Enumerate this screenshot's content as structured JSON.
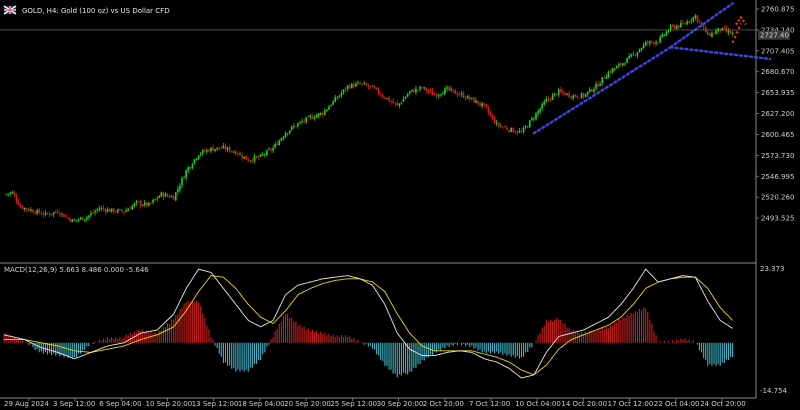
{
  "header": {
    "title": "GOLD, H4:  Gold (100 oz) vs US Dollar CFD",
    "flag_icon": "uk-flag-icon"
  },
  "colors": {
    "background": "#000000",
    "bull_candle": "#1fd41f",
    "bear_candle": "#e01d1d",
    "grid_separator": "#8a8a8a",
    "channel": "#3b47e6",
    "forecast_arrow": "#ff3030",
    "macd_line": "#e8e8e8",
    "signal_line": "#e8d800",
    "hist_positive": "#c81e1e",
    "hist_negative": "#3fb6c8",
    "text": "#d0d0d0"
  },
  "chart_data": [
    {
      "type": "candlestick",
      "symbol": "GOLD",
      "timeframe": "H4",
      "current_price": "2734.140",
      "bid_box": "2727.40",
      "y_ticks": [
        "2760.875",
        "2734.140",
        "2707.405",
        "2680.670",
        "2653.935",
        "2627.200",
        "2600.465",
        "2573.730",
        "2546.995",
        "2520.260",
        "2493.525"
      ],
      "ylim": [
        2466.79,
        2760.875
      ],
      "x_ticks": [
        "29 Aug 2024",
        "3 Sep 12:00",
        "6 Sep 04:00",
        "10 Sep 20:00",
        "13 Sep 12:00",
        "18 Sep 04:00",
        "20 Sep 20:00",
        "25 Sep 12:00",
        "30 Sep 20:00",
        "2 Oct 20:00",
        "7 Oct 12:00",
        "10 Oct 04:00",
        "14 Oct 20:00",
        "17 Oct 12:00",
        "22 Oct 04:00",
        "24 Oct 20:00"
      ],
      "close_path": [
        {
          "t": 0,
          "v": 2524
        },
        {
          "t": 4,
          "v": 2526
        },
        {
          "t": 8,
          "v": 2508
        },
        {
          "t": 14,
          "v": 2503
        },
        {
          "t": 20,
          "v": 2498
        },
        {
          "t": 26,
          "v": 2502
        },
        {
          "t": 33,
          "v": 2490
        },
        {
          "t": 40,
          "v": 2495
        },
        {
          "t": 46,
          "v": 2506
        },
        {
          "t": 52,
          "v": 2503
        },
        {
          "t": 58,
          "v": 2502
        },
        {
          "t": 64,
          "v": 2513
        },
        {
          "t": 70,
          "v": 2510
        },
        {
          "t": 76,
          "v": 2524
        },
        {
          "t": 82,
          "v": 2520
        },
        {
          "t": 88,
          "v": 2554
        },
        {
          "t": 94,
          "v": 2576
        },
        {
          "t": 100,
          "v": 2582
        },
        {
          "t": 106,
          "v": 2583
        },
        {
          "t": 112,
          "v": 2578
        },
        {
          "t": 118,
          "v": 2568
        },
        {
          "t": 124,
          "v": 2572
        },
        {
          "t": 130,
          "v": 2583
        },
        {
          "t": 136,
          "v": 2603
        },
        {
          "t": 142,
          "v": 2614
        },
        {
          "t": 148,
          "v": 2622
        },
        {
          "t": 154,
          "v": 2628
        },
        {
          "t": 160,
          "v": 2645
        },
        {
          "t": 166,
          "v": 2662
        },
        {
          "t": 172,
          "v": 2665
        },
        {
          "t": 178,
          "v": 2660
        },
        {
          "t": 184,
          "v": 2648
        },
        {
          "t": 190,
          "v": 2637
        },
        {
          "t": 196,
          "v": 2655
        },
        {
          "t": 202,
          "v": 2660
        },
        {
          "t": 208,
          "v": 2651
        },
        {
          "t": 214,
          "v": 2658
        },
        {
          "t": 220,
          "v": 2652
        },
        {
          "t": 226,
          "v": 2645
        },
        {
          "t": 232,
          "v": 2636
        },
        {
          "t": 238,
          "v": 2613
        },
        {
          "t": 244,
          "v": 2607
        },
        {
          "t": 250,
          "v": 2603
        },
        {
          "t": 256,
          "v": 2623
        },
        {
          "t": 262,
          "v": 2644
        },
        {
          "t": 268,
          "v": 2655
        },
        {
          "t": 274,
          "v": 2650
        },
        {
          "t": 280,
          "v": 2650
        },
        {
          "t": 286,
          "v": 2662
        },
        {
          "t": 292,
          "v": 2680
        },
        {
          "t": 298,
          "v": 2690
        },
        {
          "t": 304,
          "v": 2702
        },
        {
          "t": 310,
          "v": 2717
        },
        {
          "t": 316,
          "v": 2720
        },
        {
          "t": 322,
          "v": 2737
        },
        {
          "t": 328,
          "v": 2741
        },
        {
          "t": 334,
          "v": 2752
        },
        {
          "t": 337,
          "v": 2740
        },
        {
          "t": 340,
          "v": 2727
        },
        {
          "t": 346,
          "v": 2735
        },
        {
          "t": 352,
          "v": 2729
        }
      ],
      "macd": {
        "label": "MACD(12,26,9) 5.663 8.486 0.000 -5.646",
        "y_ticks": [
          "23.373",
          "-14.754"
        ],
        "ylim": [
          -14.754,
          23.373
        ],
        "line_path": [
          {
            "t": 0,
            "v": 2.5
          },
          {
            "t": 10,
            "v": 1
          },
          {
            "t": 18,
            "v": -1.5
          },
          {
            "t": 26,
            "v": -3
          },
          {
            "t": 34,
            "v": -5
          },
          {
            "t": 42,
            "v": -3
          },
          {
            "t": 50,
            "v": -1
          },
          {
            "t": 58,
            "v": 0
          },
          {
            "t": 66,
            "v": 3
          },
          {
            "t": 74,
            "v": 4
          },
          {
            "t": 82,
            "v": 9
          },
          {
            "t": 88,
            "v": 17
          },
          {
            "t": 94,
            "v": 23
          },
          {
            "t": 100,
            "v": 22
          },
          {
            "t": 106,
            "v": 17
          },
          {
            "t": 112,
            "v": 12
          },
          {
            "t": 118,
            "v": 7
          },
          {
            "t": 124,
            "v": 5
          },
          {
            "t": 130,
            "v": 7
          },
          {
            "t": 136,
            "v": 15
          },
          {
            "t": 142,
            "v": 18
          },
          {
            "t": 148,
            "v": 19
          },
          {
            "t": 154,
            "v": 20
          },
          {
            "t": 160,
            "v": 20.5
          },
          {
            "t": 166,
            "v": 21
          },
          {
            "t": 172,
            "v": 20
          },
          {
            "t": 178,
            "v": 18
          },
          {
            "t": 184,
            "v": 12
          },
          {
            "t": 190,
            "v": 3
          },
          {
            "t": 196,
            "v": -2
          },
          {
            "t": 202,
            "v": -4
          },
          {
            "t": 208,
            "v": -4
          },
          {
            "t": 214,
            "v": -3
          },
          {
            "t": 220,
            "v": -2.5
          },
          {
            "t": 226,
            "v": -3
          },
          {
            "t": 232,
            "v": -5
          },
          {
            "t": 238,
            "v": -6
          },
          {
            "t": 244,
            "v": -8
          },
          {
            "t": 250,
            "v": -11
          },
          {
            "t": 256,
            "v": -10
          },
          {
            "t": 262,
            "v": -3
          },
          {
            "t": 268,
            "v": 2
          },
          {
            "t": 274,
            "v": 3
          },
          {
            "t": 280,
            "v": 4
          },
          {
            "t": 286,
            "v": 6
          },
          {
            "t": 292,
            "v": 8
          },
          {
            "t": 298,
            "v": 12
          },
          {
            "t": 304,
            "v": 17
          },
          {
            "t": 310,
            "v": 23
          },
          {
            "t": 316,
            "v": 19
          },
          {
            "t": 322,
            "v": 20
          },
          {
            "t": 328,
            "v": 21
          },
          {
            "t": 334,
            "v": 20.5
          },
          {
            "t": 340,
            "v": 13
          },
          {
            "t": 346,
            "v": 7
          },
          {
            "t": 352,
            "v": 4.5
          }
        ],
        "signal_path": [
          {
            "t": 0,
            "v": 1
          },
          {
            "t": 10,
            "v": 1
          },
          {
            "t": 18,
            "v": 0
          },
          {
            "t": 26,
            "v": -1
          },
          {
            "t": 34,
            "v": -2.5
          },
          {
            "t": 42,
            "v": -3
          },
          {
            "t": 50,
            "v": -2
          },
          {
            "t": 58,
            "v": -1
          },
          {
            "t": 66,
            "v": 1
          },
          {
            "t": 74,
            "v": 2.5
          },
          {
            "t": 82,
            "v": 5
          },
          {
            "t": 88,
            "v": 10
          },
          {
            "t": 94,
            "v": 16
          },
          {
            "t": 100,
            "v": 21
          },
          {
            "t": 106,
            "v": 20.5
          },
          {
            "t": 112,
            "v": 17
          },
          {
            "t": 118,
            "v": 12
          },
          {
            "t": 124,
            "v": 8
          },
          {
            "t": 130,
            "v": 6
          },
          {
            "t": 136,
            "v": 10
          },
          {
            "t": 142,
            "v": 15
          },
          {
            "t": 148,
            "v": 17
          },
          {
            "t": 154,
            "v": 18.5
          },
          {
            "t": 160,
            "v": 19.5
          },
          {
            "t": 166,
            "v": 20
          },
          {
            "t": 172,
            "v": 20
          },
          {
            "t": 178,
            "v": 19
          },
          {
            "t": 184,
            "v": 16
          },
          {
            "t": 190,
            "v": 9
          },
          {
            "t": 196,
            "v": 3
          },
          {
            "t": 202,
            "v": -1
          },
          {
            "t": 208,
            "v": -2.5
          },
          {
            "t": 214,
            "v": -2.5
          },
          {
            "t": 220,
            "v": -2.5
          },
          {
            "t": 226,
            "v": -2.5
          },
          {
            "t": 232,
            "v": -3.5
          },
          {
            "t": 238,
            "v": -4.5
          },
          {
            "t": 244,
            "v": -6
          },
          {
            "t": 250,
            "v": -8.5
          },
          {
            "t": 256,
            "v": -10
          },
          {
            "t": 262,
            "v": -7
          },
          {
            "t": 268,
            "v": -2
          },
          {
            "t": 274,
            "v": 1
          },
          {
            "t": 280,
            "v": 2.5
          },
          {
            "t": 286,
            "v": 4
          },
          {
            "t": 292,
            "v": 5.5
          },
          {
            "t": 298,
            "v": 8
          },
          {
            "t": 304,
            "v": 12
          },
          {
            "t": 310,
            "v": 17
          },
          {
            "t": 316,
            "v": 19
          },
          {
            "t": 322,
            "v": 20
          },
          {
            "t": 328,
            "v": 20.5
          },
          {
            "t": 334,
            "v": 20.5
          },
          {
            "t": 340,
            "v": 17
          },
          {
            "t": 346,
            "v": 11
          },
          {
            "t": 352,
            "v": 7
          }
        ]
      }
    }
  ],
  "annotations": {
    "lower_channel_line": [
      {
        "t": 256,
        "v": 2602
      },
      {
        "t": 322,
        "v": 2712
      }
    ],
    "upper_channel_line": [
      {
        "t": 322,
        "v": 2712
      },
      {
        "t": 352,
        "v": 2768
      }
    ],
    "flat_line": [
      {
        "t": 322,
        "v": 2712
      },
      {
        "t": 370,
        "v": 2697
      }
    ],
    "forecast_arrow": [
      {
        "t": 352,
        "v": 2718
      },
      {
        "t": 356,
        "v": 2750
      }
    ]
  }
}
